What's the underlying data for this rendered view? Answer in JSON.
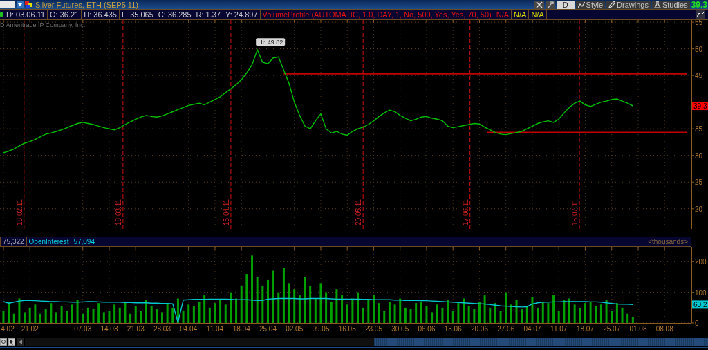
{
  "title_bar": {
    "title": "Silver Futures, ETH (SEP5 11)",
    "toolbar": [
      {
        "kind": "plain",
        "label": "D"
      },
      {
        "kind": "icon_label",
        "label": "Style"
      },
      {
        "kind": "icon_label",
        "label": "Drawings"
      },
      {
        "kind": "icon_label",
        "label": "Studies"
      }
    ],
    "last_price": "39.3"
  },
  "info_bar": {
    "cells": [
      {
        "text": "D: 03.06.11",
        "kind": "quote"
      },
      {
        "text": "O: 36.21",
        "kind": "quote"
      },
      {
        "text": "H: 36.435",
        "kind": "quote"
      },
      {
        "text": "L: 35.065",
        "kind": "quote"
      },
      {
        "text": "C: 36.285",
        "kind": "quote"
      },
      {
        "text": "R: 1.37",
        "kind": "quote"
      },
      {
        "text": "Y: 24.897",
        "kind": "quote"
      },
      {
        "text": "VolumeProfile (AUTOMATIC, 1.0, DAY, 1, No, 500, Yes, Yes, 70, 50)",
        "kind": "study"
      },
      {
        "text": "N/A",
        "kind": "study"
      },
      {
        "text": "N/A",
        "kind": "other_study"
      },
      {
        "text": "N/A",
        "kind": "other_study"
      }
    ]
  },
  "price_chart": {
    "copyright": "D Ameritrade IP Company, Inc.",
    "date_markers": [
      {
        "label": "18.02.11"
      },
      {
        "label": "18.03.11"
      },
      {
        "label": "15.04.11"
      },
      {
        "label": "20.05.11"
      },
      {
        "label": "17.06.11"
      },
      {
        "label": "15.07.11"
      }
    ],
    "high_label": "Hi: 49.82",
    "last_price_tag": "39.3",
    "chart_data": {
      "type": "line",
      "ylim": [
        16.2,
        55.4
      ],
      "yticks": [
        20,
        25,
        30,
        35,
        45,
        50,
        55
      ],
      "grid": true,
      "ref_lines": [
        {
          "axis": "y",
          "value": 45.3
        },
        {
          "axis": "y",
          "value": 34.3
        }
      ],
      "series": [
        {
          "color": "#00c000",
          "values": [
            30.5,
            30.8,
            31.2,
            31.8,
            32.3,
            32.6,
            33,
            33.5,
            34,
            34.2,
            34.5,
            34.8,
            35.2,
            35.6,
            36,
            36.2,
            36,
            35.8,
            35.5,
            35.2,
            35,
            34.8,
            35.2,
            35.8,
            36.3,
            36.8,
            37.2,
            37.5,
            37.3,
            37.2,
            37.4,
            37.8,
            38.2,
            38.6,
            39,
            39.4,
            39.6,
            39.8,
            39.5,
            40,
            40.5,
            41,
            41.8,
            42.5,
            43.3,
            44.2,
            45.5,
            47,
            49.8,
            47.5,
            47.2,
            48.3,
            48.5,
            46,
            43.5,
            40,
            37.5,
            35.5,
            35,
            36.5,
            37.8,
            35,
            34.2,
            34.5,
            34,
            33.8,
            34.5,
            35,
            35.3,
            35.8,
            36.5,
            37.3,
            38,
            38.5,
            38.2,
            37.5,
            37,
            36.5,
            36.8,
            37.2,
            37.3,
            37,
            36.8,
            36.5,
            35.5,
            35.2,
            35.4,
            35.6,
            35.8,
            36,
            35.9,
            35.3,
            34.8,
            34.3,
            34,
            33.9,
            34.1,
            34.3,
            34.5,
            35,
            35.5,
            36,
            36.3,
            36.5,
            36.2,
            36.8,
            38,
            39,
            39.8,
            40.2,
            39.5,
            39.2,
            39.6,
            40,
            40.2,
            40.5,
            40.6,
            40.2,
            39.8,
            39.3
          ]
        }
      ]
    }
  },
  "study_header": {
    "cells": [
      {
        "text": "75,322",
        "kind": "total"
      },
      {
        "text": "OpenInterest",
        "kind": "study"
      },
      {
        "text": "57,094",
        "kind": "study"
      }
    ],
    "units": "<thousands>"
  },
  "volume_chart": {
    "date_labels": [
      "4.02",
      "21.02",
      "07.03",
      "14.03",
      "21.03",
      "28.03",
      "04.04",
      "11.04",
      "18.04",
      "25.04",
      "02.05",
      "09.05",
      "16.05",
      "23.05",
      "30.05",
      "06.06",
      "13.06",
      "20.06",
      "27.06",
      "04.07",
      "11.07",
      "18.07",
      "25.07",
      "01.08",
      "08.08"
    ],
    "last_value_tag": "60.2",
    "chart_data": {
      "type": "bar",
      "ylim": [
        0,
        248
      ],
      "yticks": [
        0,
        100,
        200
      ],
      "grid": true,
      "series": [
        {
          "color": "#00a000",
          "values": [
            40,
            70,
            30,
            80,
            35,
            50,
            60,
            30,
            45,
            65,
            35,
            55,
            40,
            60,
            75,
            30,
            50,
            45,
            65,
            35,
            40,
            60,
            50,
            70,
            30,
            55,
            40,
            75,
            55,
            45,
            35,
            65,
            50,
            80,
            40,
            60,
            55,
            70,
            90,
            50,
            65,
            75,
            60,
            100,
            80,
            120,
            160,
            220,
            150,
            120,
            140,
            170,
            100,
            180,
            130,
            110,
            90,
            150,
            120,
            80,
            130,
            100,
            70,
            110,
            90,
            60,
            80,
            100,
            50,
            75,
            90,
            65,
            40,
            70,
            60,
            80,
            50,
            45,
            65,
            70,
            55,
            35,
            60,
            50,
            75,
            40,
            65,
            80,
            55,
            45,
            70,
            90,
            50,
            65,
            40,
            100,
            60,
            75,
            45,
            55,
            85,
            50,
            70,
            65,
            90,
            40,
            75,
            80,
            60,
            50,
            65,
            70,
            55,
            60,
            75,
            40,
            65,
            50,
            30,
            20
          ]
        },
        {
          "type": "line",
          "color": "#00c8d0",
          "values": [
            70,
            65,
            68,
            72,
            74,
            74,
            73,
            72,
            71,
            70,
            70,
            69,
            69,
            68,
            68,
            69,
            70,
            70,
            69,
            68,
            68,
            68,
            68,
            67,
            67,
            66,
            66,
            66,
            65,
            65,
            64,
            64,
            63,
            2,
            75,
            76,
            77,
            77,
            77,
            78,
            78,
            78,
            78,
            77,
            76,
            76,
            76,
            75,
            74,
            74,
            78,
            79,
            80,
            80,
            80,
            80,
            79,
            79,
            80,
            80,
            80,
            80,
            79,
            78,
            78,
            78,
            78,
            78,
            77,
            77,
            76,
            76,
            76,
            76,
            75,
            75,
            74,
            74,
            74,
            73,
            73,
            72,
            71,
            70,
            69,
            68,
            67,
            66,
            65,
            64,
            63,
            62,
            60,
            58,
            56,
            55,
            54,
            53,
            52,
            53,
            62,
            66,
            68,
            68,
            69,
            69,
            70,
            70,
            70,
            70,
            70,
            69,
            69,
            68,
            66,
            64,
            62,
            61,
            61,
            60
          ]
        }
      ]
    }
  }
}
